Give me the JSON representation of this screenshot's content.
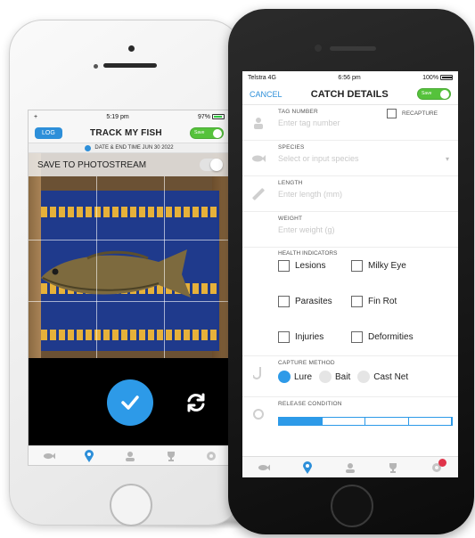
{
  "back_phone": {
    "status": {
      "left": "+ ",
      "time": "5:19 pm",
      "right": "97%"
    },
    "nav": {
      "log_label": "LOG",
      "title": "TRACK MY FISH",
      "toggle_label": "Save"
    },
    "date_bar": {
      "text": "DATE & END TIME  JUN 30 2022"
    },
    "photostream": {
      "label": "SAVE TO PHOTOSTREAM"
    },
    "icons": {
      "confirm": "check-icon",
      "switch_camera": "refresh-icon"
    }
  },
  "front_phone": {
    "status": {
      "carrier": "Telstra  4G",
      "time": "6:56 pm",
      "battery": "100%"
    },
    "nav": {
      "cancel_label": "CANCEL",
      "title": "CATCH DETAILS",
      "toggle_label": "Save"
    },
    "form": {
      "tag_number": {
        "label": "TAG NUMBER",
        "placeholder": "Enter tag number"
      },
      "recapture": {
        "label": "RECAPTURE"
      },
      "species": {
        "label": "SPECIES",
        "placeholder": "Select or input species"
      },
      "length": {
        "label": "LENGTH",
        "placeholder": "Enter length (mm)"
      },
      "weight": {
        "label": "WEIGHT",
        "placeholder": "Enter weight (g)"
      },
      "health": {
        "label": "HEALTH INDICATORS",
        "options": [
          "Lesions",
          "Milky Eye",
          "Parasites",
          "Fin Rot",
          "Injuries",
          "Deformities"
        ]
      },
      "capture": {
        "label": "CAPTURE METHOD",
        "options": [
          "Lure",
          "Bait",
          "Cast Net"
        ],
        "selected": "Lure"
      },
      "release": {
        "label": "RELEASE CONDITION"
      }
    }
  },
  "colors": {
    "accent": "#2d9ae8",
    "toggle_on": "#55c23b",
    "badge": "#e0344a"
  }
}
